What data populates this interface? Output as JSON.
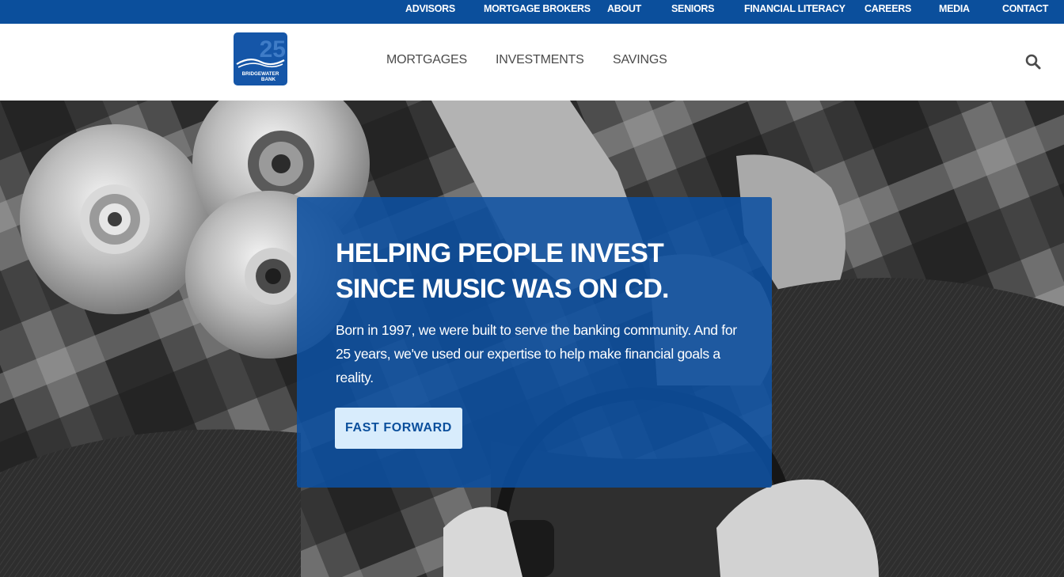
{
  "utility_nav": [
    {
      "label": "ADVISORS"
    },
    {
      "label": "MORTGAGE BROKERS"
    },
    {
      "label": "ABOUT"
    },
    {
      "label": "SENIORS"
    },
    {
      "label": "FINANCIAL LITERACY"
    },
    {
      "label": "CAREERS"
    },
    {
      "label": "MEDIA"
    },
    {
      "label": "CONTACT"
    }
  ],
  "logo": {
    "text_lines": [
      "25",
      "BRIDGEWATER",
      "BANK"
    ]
  },
  "main_nav": [
    {
      "label": "MORTGAGES"
    },
    {
      "label": "INVESTMENTS"
    },
    {
      "label": "SAVINGS"
    }
  ],
  "search": {
    "icon": "search-icon"
  },
  "hero": {
    "title": "HELPING PEOPLE INVEST SINCE MUSIC WAS ON CD.",
    "body": "Born in 1997, we were built to serve the banking community. And for 25 years, we've used our expertise to help make financial goals a reality.",
    "button_label": "FAST FORWARD"
  },
  "colors": {
    "brand_blue": "#0b4f9c",
    "button_bg": "#d8ecfc",
    "card_overlay": "#0c50a0"
  }
}
